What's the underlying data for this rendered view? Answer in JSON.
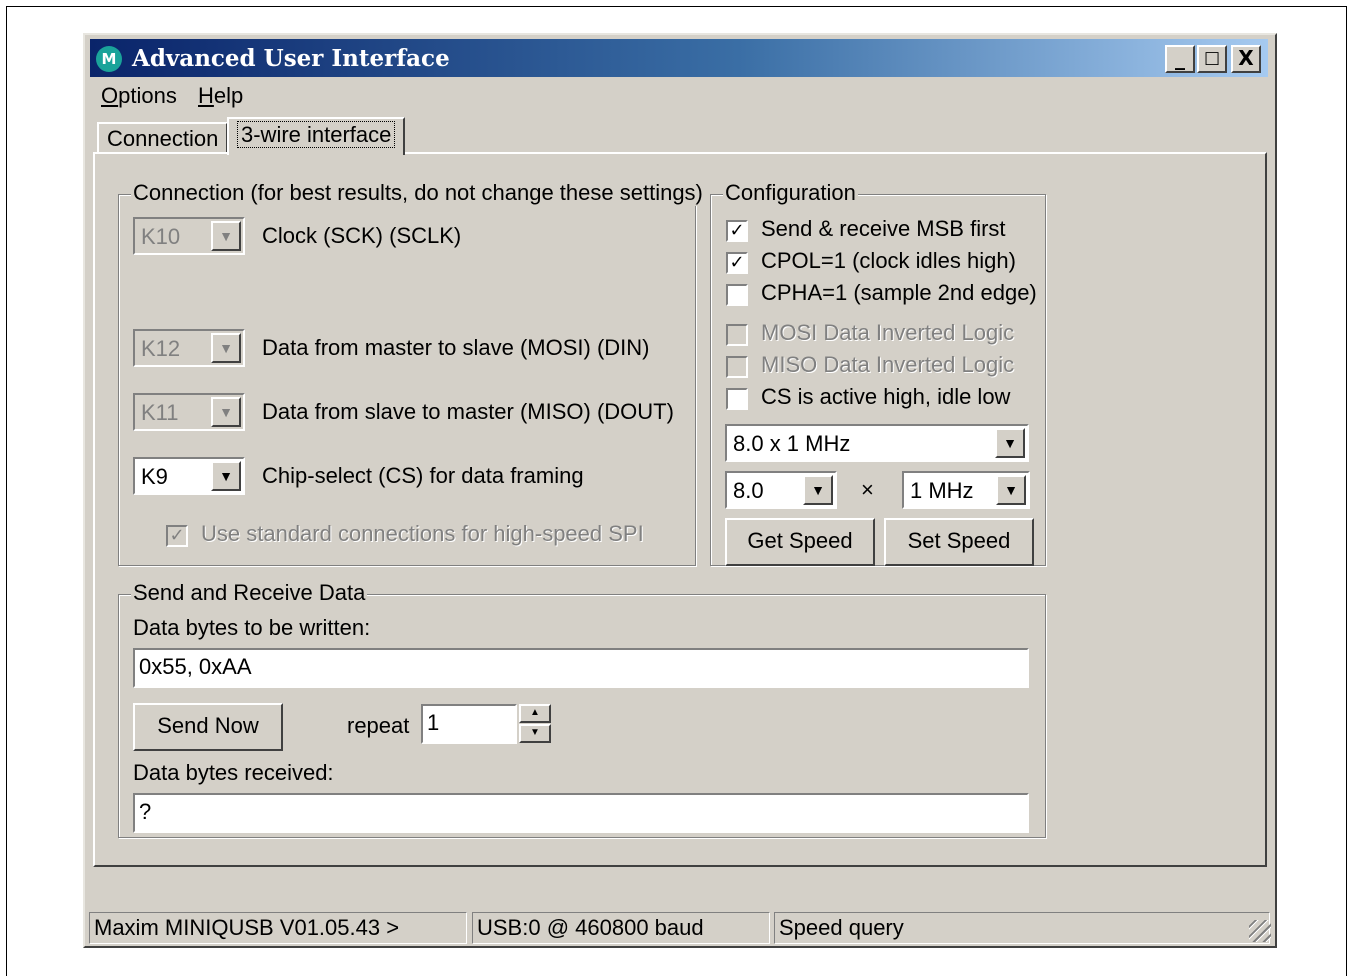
{
  "window": {
    "title": "Advanced User Interface",
    "icon_text": "M",
    "title_buttons": {
      "minimize": "_",
      "maximize": "□",
      "close": "X"
    }
  },
  "menu": {
    "options": {
      "mnemonic": "O",
      "rest": "ptions"
    },
    "help": {
      "mnemonic": "H",
      "rest": "elp"
    }
  },
  "tabs": [
    {
      "label": "Connection",
      "active": false
    },
    {
      "label": "3-wire interface",
      "active": true
    }
  ],
  "connection_group": {
    "legend": "Connection (for best results, do not change these settings)",
    "rows": [
      {
        "value": "K10",
        "label": "Clock (SCK) (SCLK)",
        "enabled": false
      },
      {
        "value": "K12",
        "label": "Data from master to slave (MOSI) (DIN)",
        "enabled": false
      },
      {
        "value": "K11",
        "label": "Data from slave to master (MISO) (DOUT)",
        "enabled": false
      },
      {
        "value": "K9",
        "label": "Chip-select (CS) for data framing",
        "enabled": true
      }
    ],
    "standard_checkbox": {
      "label": "Use standard connections for high-speed SPI",
      "checked": true,
      "enabled": false
    }
  },
  "configuration_group": {
    "legend": "Configuration",
    "options": [
      {
        "label": "Send & receive MSB first",
        "checked": true,
        "enabled": true
      },
      {
        "label": "CPOL=1 (clock idles high)",
        "checked": true,
        "enabled": true
      },
      {
        "label": "CPHA=1 (sample 2nd edge)",
        "checked": false,
        "enabled": true
      },
      {
        "label": "MOSI Data Inverted Logic",
        "checked": false,
        "enabled": false
      },
      {
        "label": "MISO Data Inverted Logic",
        "checked": false,
        "enabled": false
      },
      {
        "label": "CS is active high, idle low",
        "checked": false,
        "enabled": true
      }
    ],
    "speed_combo": "8.0 x 1 MHz",
    "multiplier": "8.0",
    "times_symbol": "×",
    "unit": "1 MHz",
    "get_speed_label": "Get Speed",
    "set_speed_label": "Set Speed"
  },
  "send_receive_group": {
    "legend": "Send and Receive Data",
    "write_label": "Data bytes to be written:",
    "write_value": "0x55, 0xAA",
    "send_now_label": "Send Now",
    "repeat_label": "repeat",
    "repeat_value": "1",
    "received_label": "Data bytes received:",
    "received_value": "?"
  },
  "status_bar": {
    "device": "Maxim MINIQUSB V01.05.43 >",
    "port": "USB:0 @ 460800 baud",
    "message": "Speed query"
  },
  "arrow_down": "▼",
  "arrow_up_small": "▲",
  "arrow_down_small": "▼",
  "check_mark": "✓"
}
